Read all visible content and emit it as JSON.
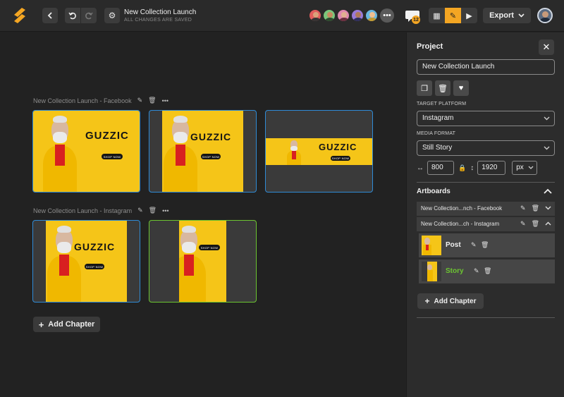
{
  "colors": {
    "accent": "#f4a623",
    "selected_blue": "#2f8bd6",
    "selected_green": "#6cc531",
    "story_label": "#6cc531",
    "poster_yellow": "#f5c518"
  },
  "header": {
    "title": "New Collection Launch",
    "subtitle": "ALL CHANGES ARE SAVED",
    "back_icon": "chevron-left-icon",
    "undo_icon": "undo-icon",
    "redo_icon": "redo-icon",
    "settings_icon": "gear-icon",
    "more_collaborators": "•••",
    "chat_badge": "12",
    "export_label": "Export"
  },
  "canvas": {
    "chapters": [
      {
        "label": "New Collection Launch - Facebook"
      },
      {
        "label": "New Collection Launch - Instagram"
      }
    ],
    "brand_text": "GUZZIC",
    "cta_text": "SHOP NOW",
    "add_chapter": "Add Chapter"
  },
  "panel": {
    "title": "Project",
    "project_name": "New Collection Launch",
    "target_platform_caption": "TARGET PLATFORM",
    "target_platform": "Instagram",
    "media_format_caption": "MEDIA FORMAT",
    "media_format": "Still Story",
    "width": "800",
    "height": "1920",
    "unit": "px",
    "artboards_title": "Artboards",
    "artboards": [
      {
        "name": "New Collection...nch - Facebook"
      },
      {
        "name": "New Collection...ch - Instagram"
      }
    ],
    "instagram_items": [
      {
        "name": "Post"
      },
      {
        "name": "Story"
      }
    ],
    "add_chapter": "Add Chapter"
  }
}
